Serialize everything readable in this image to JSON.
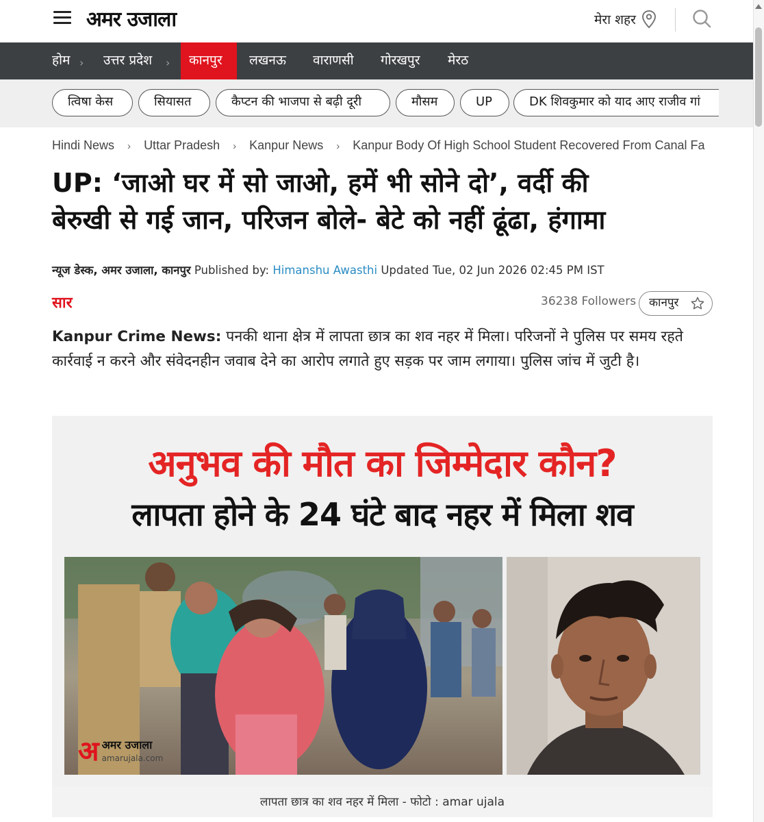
{
  "header": {
    "logo": "अमर उजाला",
    "city_label": "मेरा शहर"
  },
  "nav": {
    "items": [
      "होम",
      "उत्तर प्रदेश",
      "कानपुर",
      "लखनऊ",
      "वाराणसी",
      "गोरखपुर",
      "मेरठ"
    ],
    "active": "कानपुर"
  },
  "tags": [
    "त्विषा केस",
    "सियासत",
    "कैप्टन की भाजपा से बढ़ी दूरी",
    "मौसम",
    "UP",
    "DK शिवकुमार को याद आए राजीव गां"
  ],
  "breadcrumb": [
    "Hindi News",
    "Uttar Pradesh",
    "Kanpur News",
    "Kanpur Body Of High School Student Recovered From Canal Fa"
  ],
  "article": {
    "headline_line1": "UP: ‘जाओ घर में सो जाओ, हमें भी सोने दो’, वर्दी की",
    "headline_line2": "बेरुखी से गई  जान, परिजन बोले- बेटे को नहीं ढूंढा, हंगामा",
    "byline_desk": "न्यूज डेस्क, अमर उजाला, कानपुर",
    "byline_published_label": "Published by:",
    "byline_author": "Himanshu Awasthi",
    "byline_updated": "Updated Tue, 02 Jun 2026 02:45 PM IST",
    "saar_label": "सार",
    "followers": "36238 Followers",
    "follow_city": "कानपुर",
    "summary_lead": "Kanpur Crime News:",
    "summary_text": "पनकी थाना क्षेत्र में लापता छात्र का शव नहर में मिला। परिजनों ने पुलिस पर समय रहते कार्रवाई न करने और संवेदनहीन जवाब देने का आरोप लगाते हुए सड़क पर जाम लगाया। पुलिस जांच में जुटी है।",
    "image_text_line1": "अनुभव की मौत का जिम्मेदार कौन?",
    "image_text_line2": "लापता होने के 24 घंटे बाद नहर में मिला शव",
    "watermark_name": "अमर उजाला",
    "watermark_url": "amarujala.com",
    "caption": "लापता छात्र का शव नहर में मिला - फोटो : amar ujala"
  },
  "colors": {
    "brand_red": "#e0141e",
    "nav_bg": "#3d4043",
    "author_link": "#2b8cc4"
  }
}
